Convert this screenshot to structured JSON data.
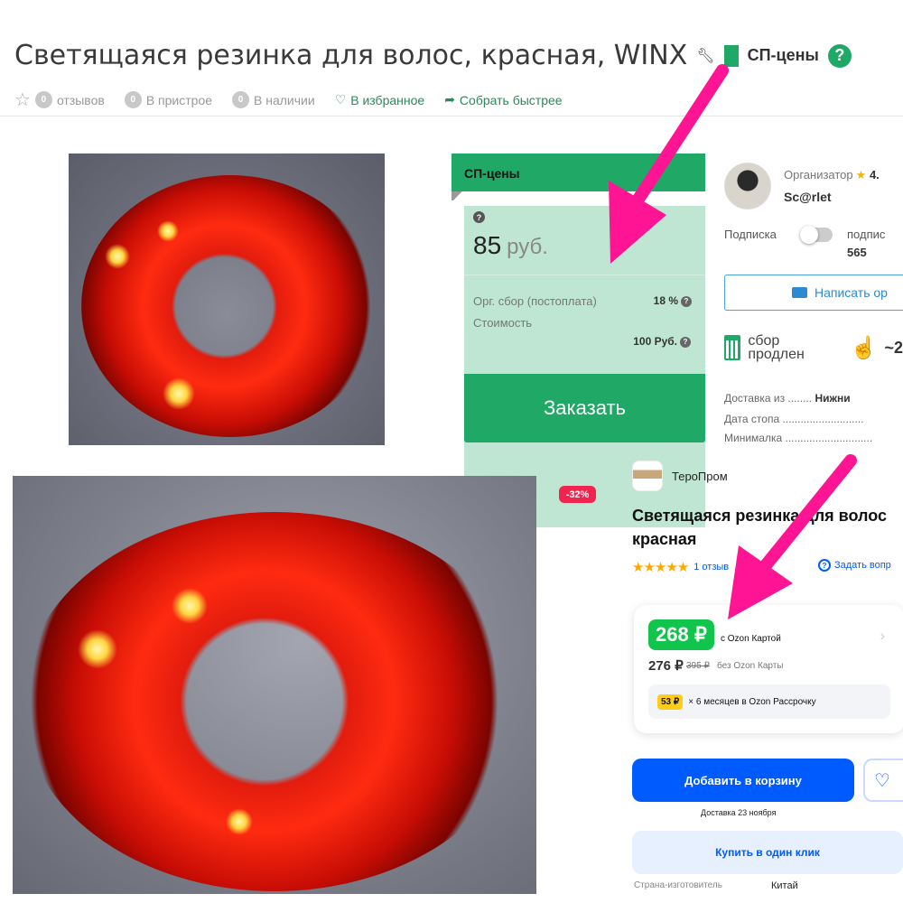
{
  "sp_page": {
    "title": "Светящаяся резинка для волос, красная, WINX",
    "badge_label": "СП-цены",
    "meta": {
      "reviews_count": "0",
      "reviews_label": "отзывов",
      "attached_count": "0",
      "attached_label": "В пристрое",
      "in_stock_count": "0",
      "in_stock_label": "В наличии",
      "favorite_label": "В избранное",
      "collect_label": "Собрать быстрее"
    },
    "price_card": {
      "header": "СП-цены",
      "price": "85",
      "currency": "руб.",
      "fee_label": "Орг. сбор (постоплата)",
      "fee_value": "18 %",
      "cost_label": "Стоимость",
      "cost_value": "100 Руб.",
      "order_button": "Заказать"
    },
    "organizer": {
      "role_label": "Организатор",
      "rating": "4.",
      "name": "Sc@rlet",
      "subscribe_label": "Подписка",
      "subscribers_label": "подпис",
      "subscribers_count": "565",
      "write_button": "Написать ор",
      "status": "сбор продлен",
      "approx_value": "~2",
      "info": [
        {
          "label": "Доставка из",
          "dots": "........",
          "value": "Нижни"
        },
        {
          "label": "Дата стопа",
          "dots": "...........................",
          "value": ""
        },
        {
          "label": "Минималка",
          "dots": ".............................",
          "value": ""
        }
      ]
    }
  },
  "ozon": {
    "discount_badge": "-32%",
    "seller": "ТероПром",
    "title": "Светящаяся резинка для волос красная",
    "rating_stars": "★★★★★",
    "reviews_link": "1 отзыв",
    "ask_link": "Задать вопр",
    "price_with_card": "268 ₽",
    "with_card_label": "с Ozon Картой",
    "price_without_card": "276 ₽",
    "price_old": "395 ₽",
    "without_card_label": "без Ozon Карты",
    "installment_badge": "53 ₽",
    "installment_text": "× 6 месяцев в Ozon Рассрочку",
    "add_to_cart": "Добавить в корзину",
    "delivery": "Доставка 23 ноября",
    "one_click": "Купить в один клик",
    "country_label": "Страна-изготовитель",
    "country_value": "Китай"
  },
  "colors": {
    "sp_green": "#1fa866",
    "sp_price_bg": "#bfe6d3",
    "ozon_blue": "#005bff",
    "ozon_green": "#10c44c",
    "ozon_discount": "#f0254f",
    "arrow_magenta": "#ff1493"
  }
}
